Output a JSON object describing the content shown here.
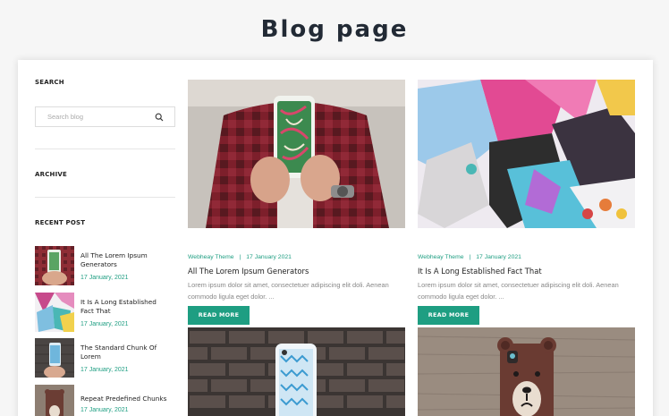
{
  "page": {
    "title": "Blog page"
  },
  "sidebar": {
    "search_heading": "SEARCH",
    "search_placeholder": "Search blog",
    "archive_heading": "ARCHIVE",
    "recent_heading": "RECENT POST",
    "recent_posts": [
      {
        "title": "All The Lorem Ipsum Generators",
        "date": "17 January, 2021"
      },
      {
        "title": "It Is A Long Established Fact That",
        "date": "17 January, 2021"
      },
      {
        "title": "The Standard Chunk Of Lorem",
        "date": "17 January, 2021"
      },
      {
        "title": "Repeat Predefined Chunks",
        "date": "17 January, 2021"
      }
    ]
  },
  "posts": [
    {
      "author": "Webheay Theme",
      "date": "17 January 2021",
      "title": "All The Lorem Ipsum Generators",
      "excerpt": "Lorem ipsum dolor sit amet, consectetuer adipiscing elit doli. Aenean commodo ligula eget dolor. ...",
      "button": "READ MORE"
    },
    {
      "author": "Webheay Theme",
      "date": "17 January 2021",
      "title": "It Is A Long Established Fact That",
      "excerpt": "Lorem ipsum dolor sit amet, consectetuer adipiscing elit doli. Aenean commodo ligula eget dolor. ...",
      "button": "READ MORE"
    }
  ],
  "meta_separator": "|",
  "colors": {
    "accent": "#1e9e82",
    "heading": "#222a35",
    "muted": "#888888"
  }
}
